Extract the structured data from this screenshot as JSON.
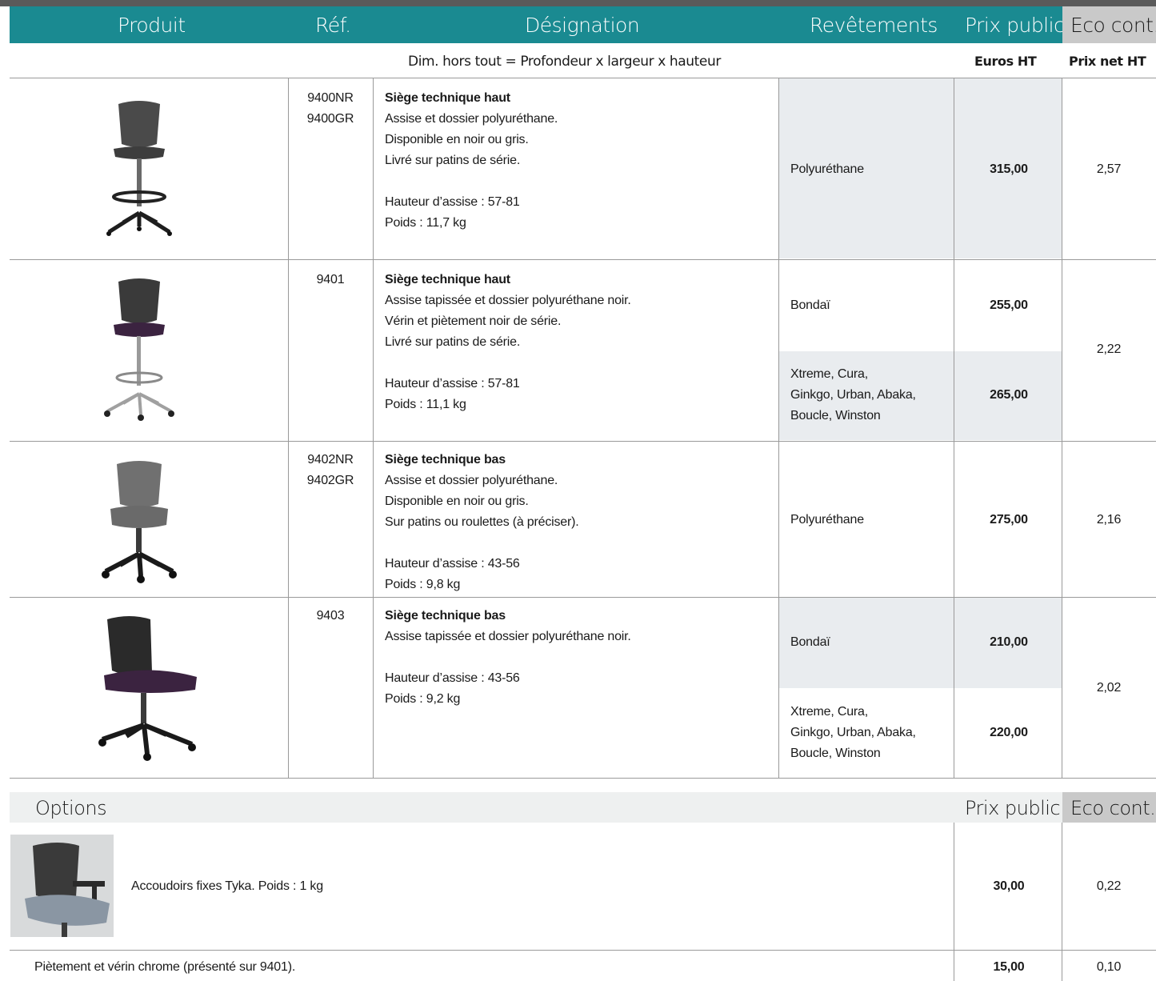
{
  "header": {
    "produit": "Produit",
    "ref": "Réf.",
    "designation": "Désignation",
    "revetements": "Revêtements",
    "prix_public": "Prix public",
    "eco": "Eco cont."
  },
  "subheader": {
    "dims": "Dim. hors tout = Profondeur x largeur x hauteur",
    "euros": "Euros HT",
    "prix_net": "Prix net HT"
  },
  "rows": [
    {
      "ref": [
        "9400NR",
        "9400GR"
      ],
      "title": "Siège technique haut",
      "lines": [
        "Assise et dossier polyuréthane.",
        "Disponible en noir ou gris.",
        "Livré sur patins de série.",
        "",
        "Hauteur d’assise : 57-81",
        "Poids : 11,7 kg"
      ],
      "coverings": [
        {
          "name": [
            "Polyuréthane"
          ],
          "price": "315,00"
        }
      ],
      "eco": "2,57"
    },
    {
      "ref": [
        "9401"
      ],
      "title": "Siège technique haut",
      "lines": [
        "Assise tapissée et dossier polyuréthane noir.",
        "Vérin et piètement noir de série.",
        "Livré sur patins de série.",
        "",
        "Hauteur d’assise : 57-81",
        "Poids : 11,1 kg"
      ],
      "coverings": [
        {
          "name": [
            "Bondaï"
          ],
          "price": "255,00"
        },
        {
          "name": [
            "Xtreme, Cura,",
            "Ginkgo, Urban, Abaka,",
            "Boucle, Winston"
          ],
          "price": "265,00"
        }
      ],
      "eco": "2,22"
    },
    {
      "ref": [
        "9402NR",
        "9402GR"
      ],
      "title": "Siège technique bas",
      "lines": [
        "Assise et dossier polyuréthane.",
        "Disponible en noir ou gris.",
        "Sur patins ou roulettes (à préciser).",
        "",
        "Hauteur d’assise : 43-56",
        "Poids : 9,8 kg"
      ],
      "coverings": [
        {
          "name": [
            "Polyuréthane"
          ],
          "price": "275,00"
        }
      ],
      "eco": "2,16"
    },
    {
      "ref": [
        "9403"
      ],
      "title": "Siège technique bas",
      "lines": [
        "Assise tapissée et dossier polyuréthane noir.",
        "",
        "Hauteur d’assise : 43-56",
        "Poids : 9,2 kg"
      ],
      "coverings": [
        {
          "name": [
            "Bondaï"
          ],
          "price": "210,00"
        },
        {
          "name": [
            "Xtreme, Cura,",
            "Ginkgo, Urban, Abaka,",
            "Boucle, Winston"
          ],
          "price": "220,00"
        }
      ],
      "eco": "2,02"
    }
  ],
  "options": {
    "title": "Options",
    "prix_public": "Prix public",
    "eco": "Eco cont.",
    "items": [
      {
        "label": "Accoudoirs fixes Tyka. Poids : 1 kg",
        "price": "30,00",
        "eco": "0,22"
      },
      {
        "label": "Piètement et vérin chrome (présenté sur 9401).",
        "price": "15,00",
        "eco": "0,10"
      }
    ]
  },
  "colors": {
    "teal": "#1a8a91",
    "grey_header": "#c9c9c9",
    "shade": "#e9ecef"
  }
}
